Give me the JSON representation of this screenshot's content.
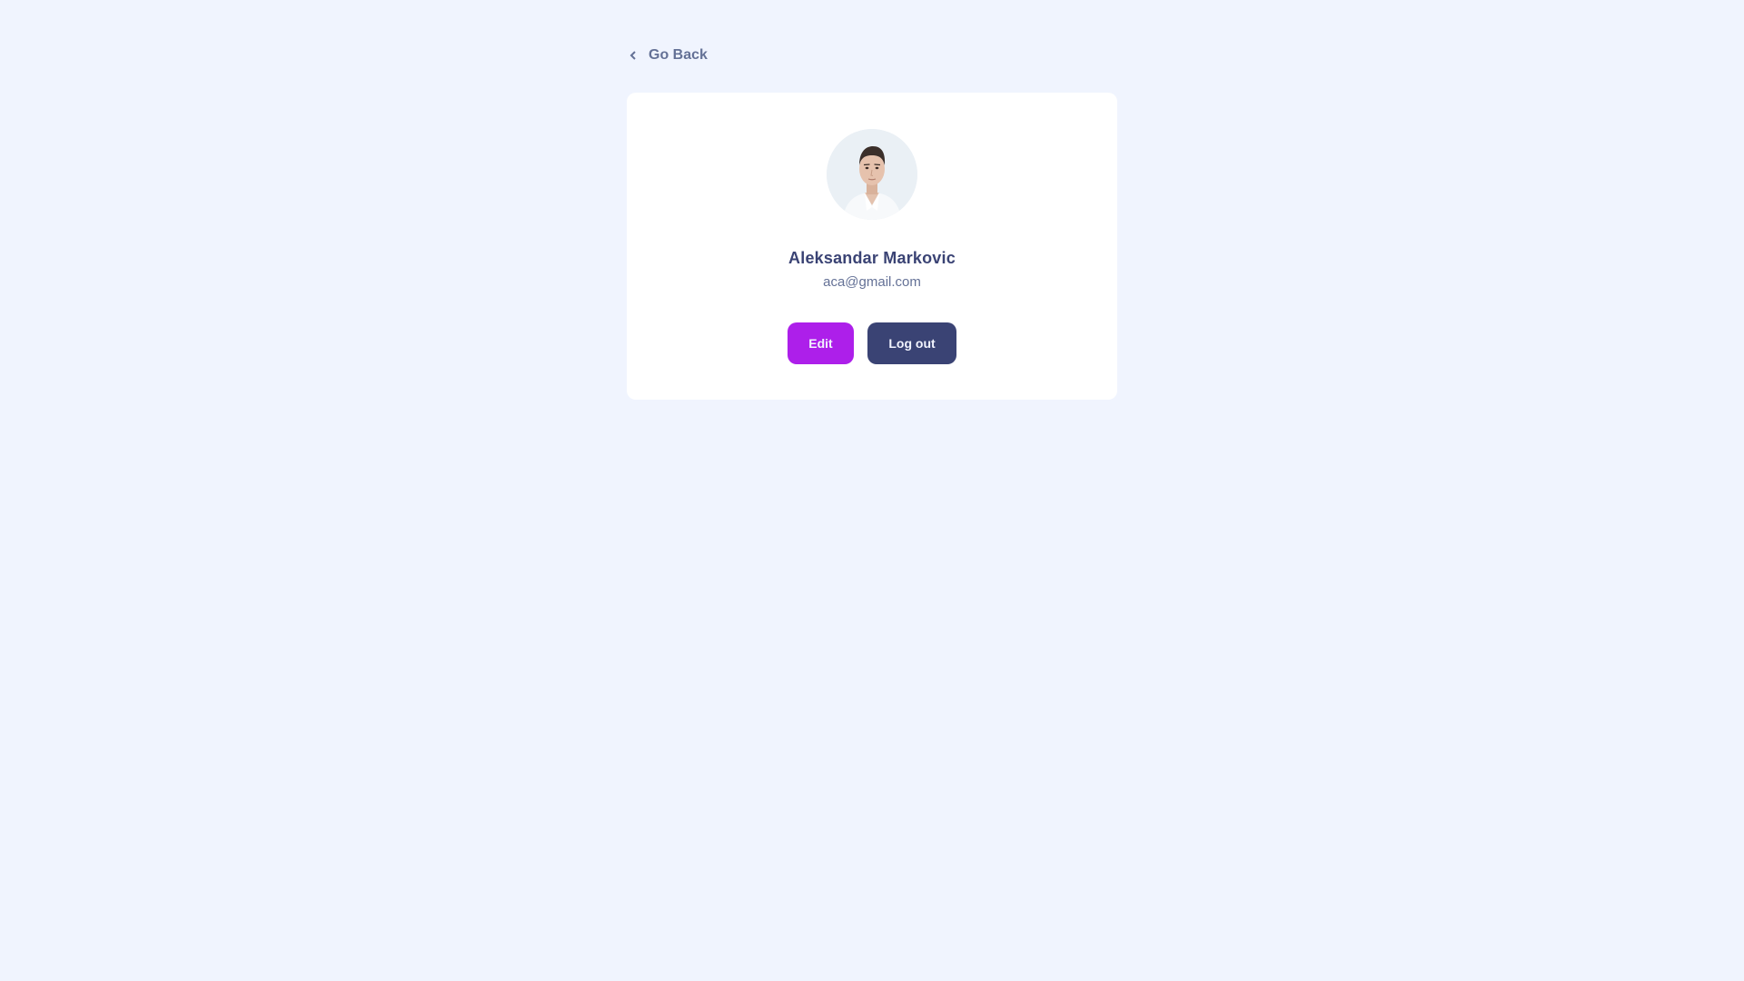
{
  "nav": {
    "back_label": "Go Back",
    "back_icon": "chevron-left-icon"
  },
  "profile": {
    "name": "Aleksandar Markovic",
    "email": "aca@gmail.com",
    "avatar_icon": "user-avatar"
  },
  "actions": {
    "edit_label": "Edit",
    "logout_label": "Log out"
  },
  "colors": {
    "background": "#f0f4fe",
    "card": "#ffffff",
    "primary": "#ad1fea",
    "secondary": "#3a4374",
    "muted_text": "#647196"
  }
}
